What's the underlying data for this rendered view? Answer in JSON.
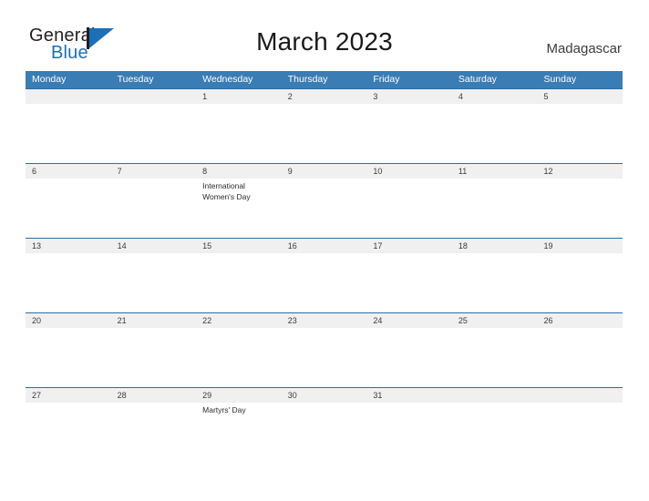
{
  "brand": {
    "name_part1": "General",
    "name_part2": "Blue",
    "accent_color": "#1d6fb8",
    "mark_icon": "triangle-flag-icon"
  },
  "header": {
    "title": "March 2023",
    "country": "Madagascar"
  },
  "colors": {
    "header_band": "#3a7cb4",
    "week_band": "#f0f0f0",
    "week_rule": "#2e6da4",
    "text": "#3a3a3a"
  },
  "calendar": {
    "weekdays": [
      "Monday",
      "Tuesday",
      "Wednesday",
      "Thursday",
      "Friday",
      "Saturday",
      "Sunday"
    ],
    "weeks": [
      {
        "days": [
          {
            "num": "",
            "event": ""
          },
          {
            "num": "",
            "event": ""
          },
          {
            "num": "1",
            "event": ""
          },
          {
            "num": "2",
            "event": ""
          },
          {
            "num": "3",
            "event": ""
          },
          {
            "num": "4",
            "event": ""
          },
          {
            "num": "5",
            "event": ""
          }
        ]
      },
      {
        "days": [
          {
            "num": "6",
            "event": ""
          },
          {
            "num": "7",
            "event": ""
          },
          {
            "num": "8",
            "event": "International Women's Day"
          },
          {
            "num": "9",
            "event": ""
          },
          {
            "num": "10",
            "event": ""
          },
          {
            "num": "11",
            "event": ""
          },
          {
            "num": "12",
            "event": ""
          }
        ]
      },
      {
        "days": [
          {
            "num": "13",
            "event": ""
          },
          {
            "num": "14",
            "event": ""
          },
          {
            "num": "15",
            "event": ""
          },
          {
            "num": "16",
            "event": ""
          },
          {
            "num": "17",
            "event": ""
          },
          {
            "num": "18",
            "event": ""
          },
          {
            "num": "19",
            "event": ""
          }
        ]
      },
      {
        "days": [
          {
            "num": "20",
            "event": ""
          },
          {
            "num": "21",
            "event": ""
          },
          {
            "num": "22",
            "event": ""
          },
          {
            "num": "23",
            "event": ""
          },
          {
            "num": "24",
            "event": ""
          },
          {
            "num": "25",
            "event": ""
          },
          {
            "num": "26",
            "event": ""
          }
        ]
      },
      {
        "days": [
          {
            "num": "27",
            "event": ""
          },
          {
            "num": "28",
            "event": ""
          },
          {
            "num": "29",
            "event": "Martyrs' Day"
          },
          {
            "num": "30",
            "event": ""
          },
          {
            "num": "31",
            "event": ""
          },
          {
            "num": "",
            "event": ""
          },
          {
            "num": "",
            "event": ""
          }
        ]
      }
    ]
  }
}
